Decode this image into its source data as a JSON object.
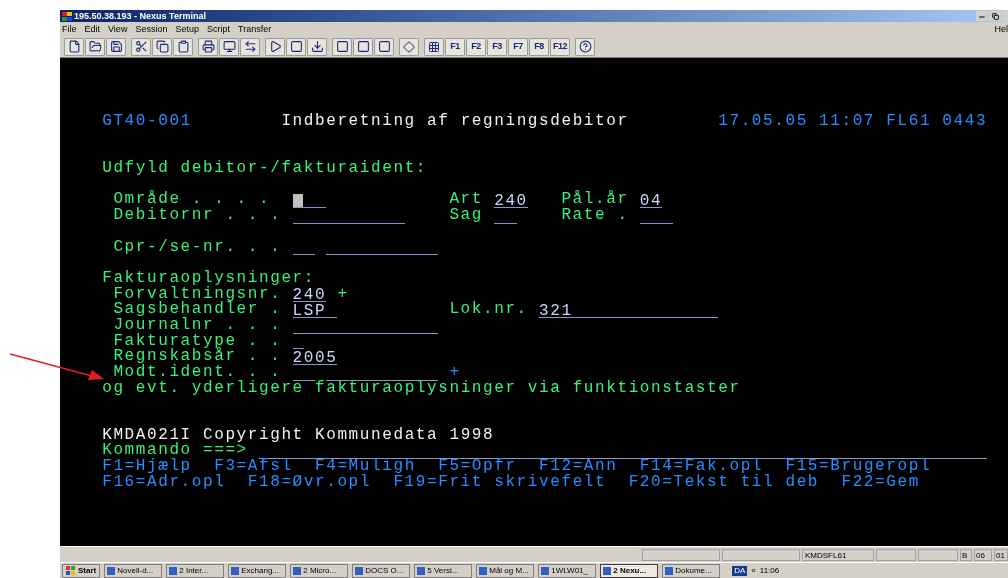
{
  "window": {
    "title": "195.50.38.193 - Nexus Terminal"
  },
  "menu": [
    "File",
    "Edit",
    "View",
    "Session",
    "Setup",
    "Script",
    "Transfer"
  ],
  "help_menu": "Hel",
  "macro_buttons": [
    "F1",
    "F2",
    "F3",
    "F7",
    "F8",
    "F12"
  ],
  "screen": {
    "rows": [
      {
        "segments": [
          {
            "kind": "info",
            "text": "GT40-001"
          },
          {
            "kind": "title",
            "text": "Indberetning af regningsdebitor"
          },
          {
            "kind": "info",
            "text": "17.05.05 11:07 FL61 0443"
          }
        ]
      },
      {
        "segments": [
          {
            "kind": "label",
            "text": "Udfyld debitor-/fakturaident:"
          }
        ]
      },
      {
        "segments": [
          {
            "kind": "label",
            "text": "Område . . . ."
          },
          {
            "kind": "field",
            "cursor": true
          },
          {
            "kind": "label",
            "text": "Art"
          },
          {
            "kind": "field",
            "value": "240",
            "cursor": false
          },
          {
            "kind": "label",
            "text": "Pål.år"
          },
          {
            "kind": "field",
            "value": "04",
            "cursor": false
          }
        ]
      },
      {
        "segments": [
          {
            "kind": "label",
            "text": "Debitornr . . ."
          },
          {
            "kind": "field",
            "cursor": false
          },
          {
            "kind": "label",
            "text": "Sag"
          },
          {
            "kind": "field",
            "cursor": false
          },
          {
            "kind": "label",
            "text": "Rate ."
          },
          {
            "kind": "field",
            "cursor": false
          }
        ]
      },
      {
        "segments": [
          {
            "kind": "label",
            "text": "Cpr-/se-nr. . ."
          },
          {
            "kind": "field",
            "cursor": false
          },
          {
            "kind": "field",
            "cursor": false
          }
        ]
      },
      {
        "segments": [
          {
            "kind": "label",
            "text": "Fakturaoplysninger:"
          }
        ]
      },
      {
        "segments": [
          {
            "kind": "label",
            "text": "Forvaltningsnr."
          },
          {
            "kind": "field",
            "value": "240",
            "cursor": false
          },
          {
            "kind": "label",
            "text": "+"
          }
        ]
      },
      {
        "segments": [
          {
            "kind": "label",
            "text": "Sagsbehandler ."
          },
          {
            "kind": "field",
            "value": "LSP",
            "cursor": false
          },
          {
            "kind": "label",
            "text": "Lok.nr."
          },
          {
            "kind": "field",
            "value": "321",
            "cursor": false
          }
        ]
      },
      {
        "segments": [
          {
            "kind": "label",
            "text": "Journalnr . . ."
          },
          {
            "kind": "field",
            "cursor": false
          }
        ]
      },
      {
        "segments": [
          {
            "kind": "label",
            "text": "Fakturatype . ."
          },
          {
            "kind": "field",
            "cursor": false
          }
        ]
      },
      {
        "segments": [
          {
            "kind": "label",
            "text": "Regnskabsår . ."
          },
          {
            "kind": "field",
            "value": "2005",
            "cursor": false
          }
        ]
      },
      {
        "segments": [
          {
            "kind": "label",
            "text": "Modt.ident. . ."
          },
          {
            "kind": "field",
            "cursor": false
          },
          {
            "kind": "field",
            "cursor": false
          },
          {
            "kind": "info",
            "text": "+"
          }
        ]
      },
      {
        "segments": [
          {
            "kind": "label",
            "text": "og evt. yderligere fakturaoplysninger via funktionstaster"
          }
        ]
      },
      {
        "segments": [
          {
            "kind": "title",
            "text": "KMDA021I Copyright Kommunedata 1998"
          }
        ]
      },
      {
        "segments": [
          {
            "kind": "label",
            "text": "Kommando ===>"
          },
          {
            "kind": "field",
            "cursor": false
          }
        ]
      }
    ],
    "function_keys": [
      [
        "F1=Hjælp",
        "F3=Afsl",
        "F4=Muligh",
        "F5=Opfr",
        "F12=Ann",
        "F14=Fak.opl",
        "F15=Brugeropl"
      ],
      [
        "F16=Adr.opl",
        "F18=Øvr.opl",
        "F19=Frit skrivefelt",
        "F20=Tekst til deb",
        "F22=Gem"
      ]
    ]
  },
  "status_bar": [
    "KMDSFL61",
    "B",
    "06",
    "01"
  ],
  "taskbar": {
    "start": "Start",
    "tasks": [
      {
        "label": "Novell-d...",
        "selected": false
      },
      {
        "label": "2 Inter...",
        "selected": false
      },
      {
        "label": "Exchang...",
        "selected": false
      },
      {
        "label": "2 Micro...",
        "selected": false
      },
      {
        "label": "DOCS O...",
        "selected": false
      },
      {
        "label": "5 Versi...",
        "selected": false
      },
      {
        "label": "Mål og M...",
        "selected": false
      },
      {
        "label": "1WLW01_",
        "selected": false
      },
      {
        "label": "2 Nexu...",
        "selected": true
      },
      {
        "label": "Dokume...",
        "selected": false
      }
    ],
    "language": "DA",
    "chevron": "«",
    "clock": "11:06"
  }
}
